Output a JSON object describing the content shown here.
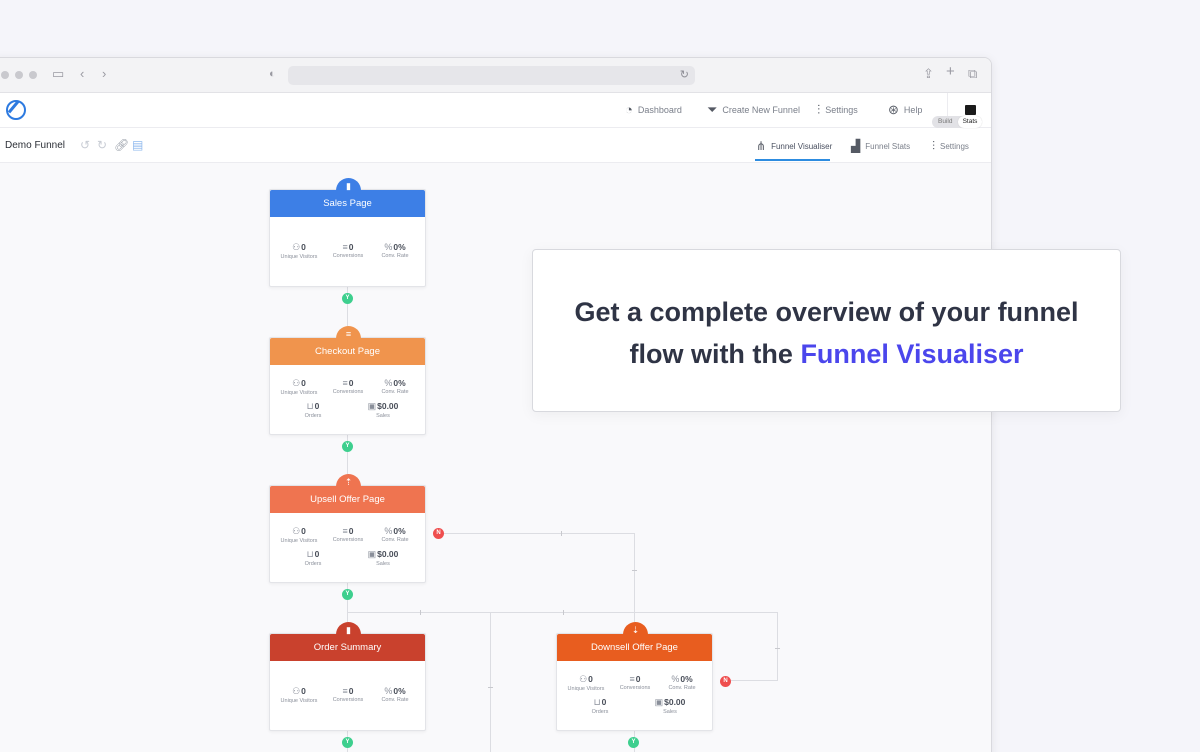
{
  "browser": {
    "icons": [
      "sidebar-icon",
      "back-icon",
      "forward-icon",
      "shield-icon",
      "reload-icon",
      "share-icon",
      "new-tab-icon",
      "tabs-icon"
    ]
  },
  "nav": {
    "dashboard": "Dashboard",
    "create_new_funnel": "Create New Funnel",
    "settings": "Settings",
    "help": "Help"
  },
  "funnel_bar": {
    "name": "Demo Funnel",
    "tabs": {
      "visualiser": "Funnel Visualiser",
      "stats": "Funnel Stats",
      "settings": "Settings"
    }
  },
  "toggle": {
    "build": "Build",
    "stats": "Stats",
    "active": "Stats"
  },
  "labels": {
    "visitors": "Unique Visitors",
    "conversions": "Conversions",
    "rate": "Conv. Rate",
    "orders": "Orders",
    "sales": "Sales"
  },
  "nodes": {
    "sales": {
      "title": "Sales Page",
      "color": "#3d7fe6",
      "visitors": "0",
      "conversions": "0",
      "rate": "0%"
    },
    "checkout": {
      "title": "Checkout Page",
      "color": "#f0944d",
      "visitors": "0",
      "conversions": "0",
      "rate": "0%",
      "orders": "0",
      "sales": "$0.00"
    },
    "upsell": {
      "title": "Upsell Offer Page",
      "color": "#ef7450",
      "visitors": "0",
      "conversions": "0",
      "rate": "0%",
      "orders": "0",
      "sales": "$0.00"
    },
    "order_summary": {
      "title": "Order Summary",
      "color": "#c9412d",
      "visitors": "0",
      "conversions": "0",
      "rate": "0%"
    },
    "downsell": {
      "title": "Downsell Offer Page",
      "color": "#e85d1f",
      "visitors": "0",
      "conversions": "0",
      "rate": "0%",
      "orders": "0",
      "sales": "$0.00"
    }
  },
  "connectors": {
    "yes": "Y",
    "no": "N"
  },
  "callout": {
    "line1": "Get a complete overview of your funnel",
    "line2_prefix": "flow with the ",
    "line2_highlight": "Funnel Visualiser"
  }
}
